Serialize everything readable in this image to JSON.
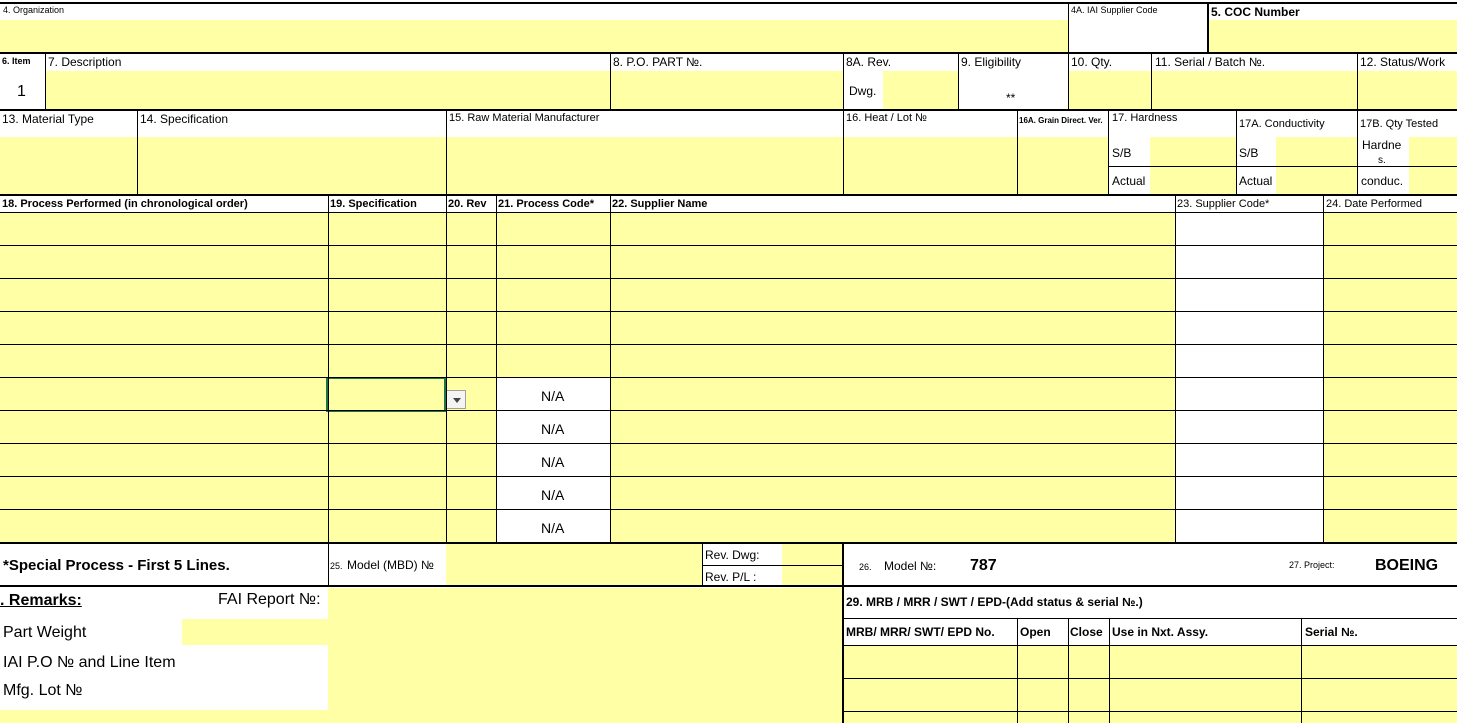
{
  "row1": {
    "organization": "4. Organization",
    "supplier_code": "4A. IAI Supplier Code",
    "coc_number": "5. COC Number"
  },
  "row2": {
    "item": "6. Item",
    "item_value": "1",
    "description": "7.  Description",
    "po_part": "8. P.O. PART №.",
    "rev": "8A.  Rev.",
    "dwg": "Dwg.",
    "eligibility": "9. Eligibility",
    "eligibility_value": "**",
    "qty": "10. Qty.",
    "serial_batch": "11. Serial / Batch №.",
    "status_work": "12. Status/Work"
  },
  "row3": {
    "material_type": "13.  Material Type",
    "specification": "14. Specification",
    "raw_material_mfr": "15. Raw Material Manufacturer",
    "heat_lot": "16. Heat / Lot №",
    "grain_direct": "16A. Grain Direct. Ver.",
    "hardness": "17. Hardness",
    "conductivity": "17A. Conductivity",
    "qty_tested": "17B. Qty Tested",
    "sb": "S/B",
    "actual": "Actual",
    "hardness_short": "Hardne",
    "hardness_short2": "s.",
    "conduc": "conduc."
  },
  "process_header": {
    "process": "18. Process Performed (in chronological order)",
    "spec": "19. Specification",
    "rev": "20. Rev",
    "code": "21. Process Code*",
    "supplier_name": "22. Supplier Name",
    "supplier_code": "23. Supplier Code*",
    "date": "24.  Date Performed"
  },
  "process_rows": {
    "na": "N/A"
  },
  "footer": {
    "special_process": "*Special Process - First 5 Lines.",
    "model_mbd": "25. Model (MBD) №",
    "model_mbd_num": "25.",
    "model_mbd_label": "Model (MBD) №",
    "rev_dwg": "Rev. Dwg:",
    "rev_pl": "Rev. P/L :",
    "model_no_num": "26.",
    "model_no_label": "Model №:",
    "model_no_value": "787",
    "project_label": "27. Project:",
    "project_value": "BOEING"
  },
  "remarks": {
    "remarks": ".  Remarks:",
    "fai_report": "FAI Report №:",
    "part_weight": "Part Weight",
    "iai_po": "IAI P.O № and Line Item",
    "mfg_lot": "Mfg. Lot №"
  },
  "mrb": {
    "title": "29.  MRB / MRR / SWT / EPD-(Add status & serial №.)",
    "col_no": "MRB/ MRR/ SWT/ EPD No.",
    "col_open": "Open",
    "col_close": "Close",
    "col_use": "Use in Nxt. Assy.",
    "col_serial": "Serial №."
  },
  "colors": {
    "cell_fill": "#ffffa6",
    "grid": "#000000",
    "selection": "#217346"
  }
}
